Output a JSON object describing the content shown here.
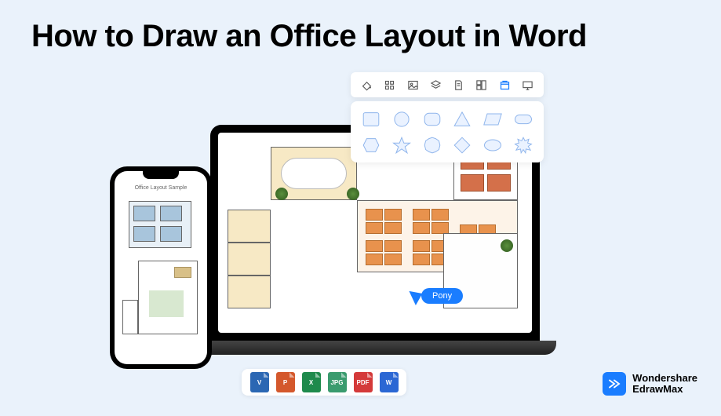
{
  "title": "How to Draw an Office Layout in Word",
  "sample_label": "Office Layout Sample",
  "phone_label": "Office Layout Sample",
  "cursor_user": "Pony",
  "toolbar_icons": [
    "fill",
    "grid",
    "image",
    "layers",
    "page",
    "components",
    "library",
    "present"
  ],
  "shape_names": [
    "rectangle",
    "circle",
    "rounded-rect",
    "triangle",
    "parallelogram",
    "capsule",
    "hexagon",
    "star",
    "badge",
    "diamond",
    "ellipse",
    "burst"
  ],
  "file_formats": [
    {
      "label": "V",
      "color": "#2b67b3"
    },
    {
      "label": "P",
      "color": "#d4582c"
    },
    {
      "label": "X",
      "color": "#1f8a4c"
    },
    {
      "label": "JPG",
      "color": "#3a9b6e"
    },
    {
      "label": "PDF",
      "color": "#d43a3a"
    },
    {
      "label": "W",
      "color": "#2b67d4"
    }
  ],
  "brand": {
    "line1": "Wondershare",
    "line2": "EdrawMax"
  }
}
